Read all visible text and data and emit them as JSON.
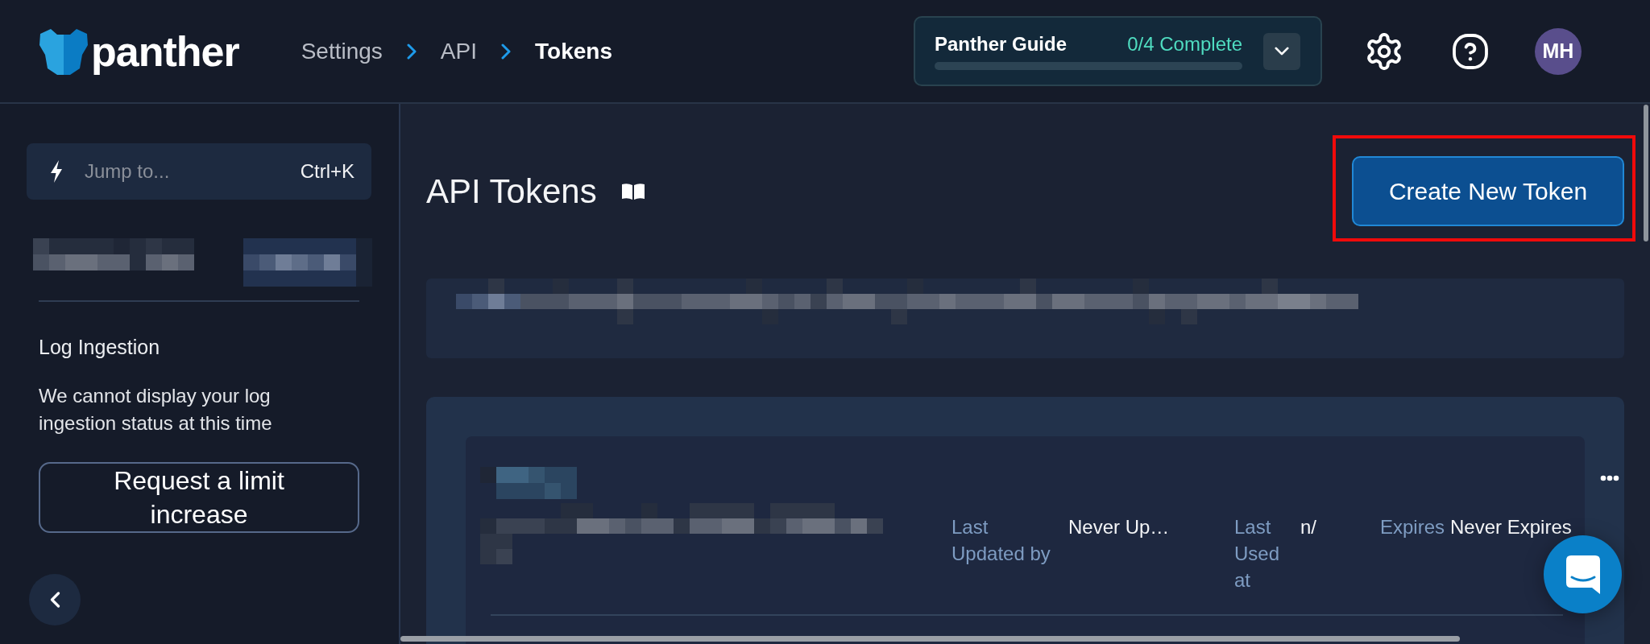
{
  "header": {
    "logo_text": "panther",
    "breadcrumbs": [
      {
        "label": "Settings",
        "current": false
      },
      {
        "label": "API",
        "current": false
      },
      {
        "label": "Tokens",
        "current": true
      }
    ],
    "guide": {
      "title": "Panther Guide",
      "status": "0/4 Complete",
      "expanded": false
    },
    "avatar": {
      "initials": "MH"
    }
  },
  "sidebar": {
    "search": {
      "placeholder": "Jump to...",
      "shortcut": "Ctrl+K"
    },
    "log_ingestion": {
      "title": "Log Ingestion",
      "message": "We cannot display your log ingestion status at this time",
      "button": "Request a limit increase"
    }
  },
  "page": {
    "title": "API Tokens",
    "create_button": {
      "label": "Create New Token",
      "highlighted": true
    }
  },
  "tokens": [
    {
      "fields": [
        {
          "label": "Last Updated by",
          "value": "Never Up…"
        },
        {
          "label": "Last Used at",
          "value": "n/"
        },
        {
          "label": "Expires",
          "value": "Never Expires"
        }
      ]
    }
  ]
}
